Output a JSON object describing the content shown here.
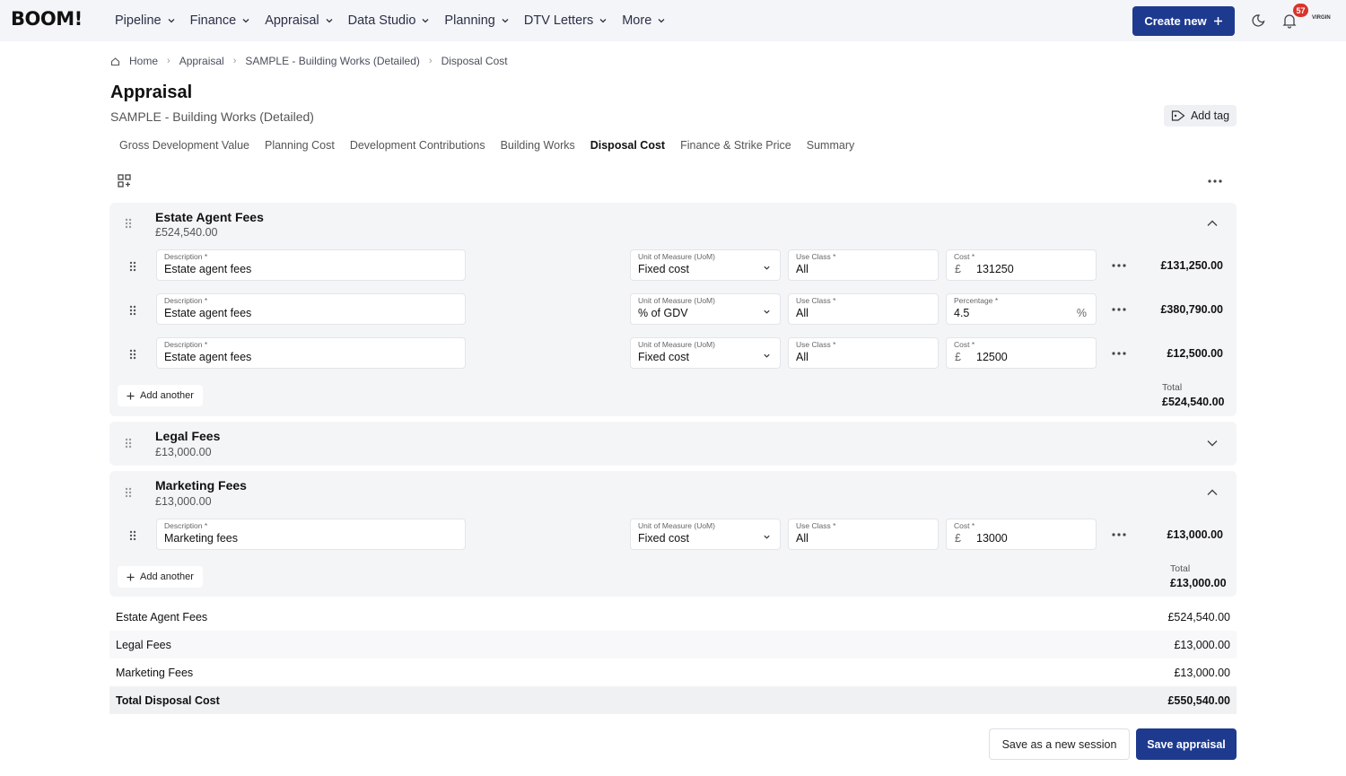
{
  "app": {
    "logo": "BOOM!"
  },
  "nav": {
    "items": [
      "Pipeline",
      "Finance",
      "Appraisal",
      "Data Studio",
      "Planning",
      "DTV Letters",
      "More"
    ],
    "create_label": "Create new",
    "notification_count": "57",
    "avatar_text": "VIRGIN"
  },
  "breadcrumb": [
    "Home",
    "Appraisal",
    "SAMPLE - Building Works (Detailed)",
    "Disposal Cost"
  ],
  "page": {
    "title": "Appraisal",
    "subtitle": "SAMPLE - Building Works (Detailed)",
    "add_tag_label": "Add tag"
  },
  "tabs": [
    "Gross Development Value",
    "Planning Cost",
    "Development Contributions",
    "Building Works",
    "Disposal Cost",
    "Finance & Strike Price",
    "Summary"
  ],
  "active_tab": "Disposal Cost",
  "labels": {
    "description": "Description",
    "uom": "Unit of Measure (UoM)",
    "use_class": "Use Class",
    "cost": "Cost",
    "percentage": "Percentage",
    "currency": "£",
    "percent_sign": "%",
    "required": "*",
    "add_another": "Add another",
    "total": "Total"
  },
  "sections": [
    {
      "title": "Estate Agent Fees",
      "amount": "£524,540.00",
      "expanded": true,
      "rows": [
        {
          "description": "Estate agent fees",
          "uom": "Fixed cost",
          "use_class": "All",
          "value_type": "cost",
          "value": "131250",
          "total": "£131,250.00"
        },
        {
          "description": "Estate agent fees",
          "uom": "% of GDV",
          "use_class": "All",
          "value_type": "percentage",
          "value": "4.5",
          "total": "£380,790.00"
        },
        {
          "description": "Estate agent fees",
          "uom": "Fixed cost",
          "use_class": "All",
          "value_type": "cost",
          "value": "12500",
          "total": "£12,500.00"
        }
      ],
      "total": "£524,540.00"
    },
    {
      "title": "Legal Fees",
      "amount": "£13,000.00",
      "expanded": false
    },
    {
      "title": "Marketing Fees",
      "amount": "£13,000.00",
      "expanded": true,
      "rows": [
        {
          "description": "Marketing fees",
          "uom": "Fixed cost",
          "use_class": "All",
          "value_type": "cost",
          "value": "13000",
          "total": "£13,000.00"
        }
      ],
      "total": "£13,000.00"
    }
  ],
  "summary": [
    {
      "label": "Estate Agent Fees",
      "value": "£524,540.00"
    },
    {
      "label": "Legal Fees",
      "value": "£13,000.00"
    },
    {
      "label": "Marketing Fees",
      "value": "£13,000.00"
    }
  ],
  "summary_total": {
    "label": "Total Disposal Cost",
    "value": "£550,540.00"
  },
  "actions": {
    "save_session": "Save as a new session",
    "save_appraisal": "Save appraisal"
  },
  "colors": {
    "primary": "#1d3a8f",
    "badge": "#d9342b",
    "section_bg": "#f4f5f7"
  }
}
